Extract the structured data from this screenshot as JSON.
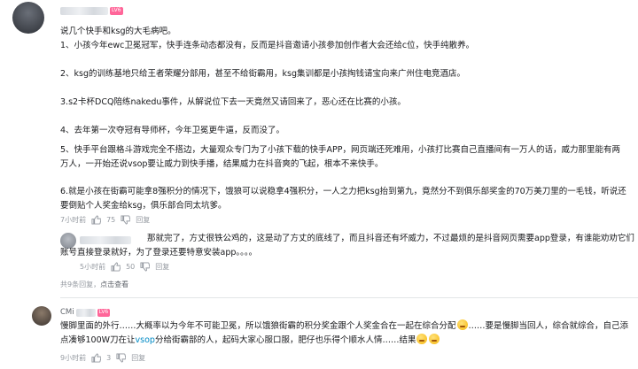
{
  "top_comment": {
    "level_badge": "LV6",
    "paragraphs": [
      "说几个快手和ksg的大毛病吧。",
      "1、小孩今年ewc卫冕冠军，快手连条动态都没有，反而是抖音邀请小孩参加创作者大会还给c位，快手纯散养。",
      "2、ksg的训练基地只给王者荣耀分部用，甚至不给街霸用，ksg集训都是小孩掏钱请宝向来广州住电竞酒店。",
      "3.s2卡杯DCQ陪练nakedu事件，从解说位下去一天竟然又请回来了，恶心还在比赛的小孩。",
      "4、去年第一次夺冠有导师杯，今年卫冕更牛逼，反而没了。",
      "5、快手平台跟格斗游戏完全不搭边，大量观众专门为了小孩下载的快手APP，网页端还死难用，小孩打比赛自己直播间有一万人的话，威力那里能有两万人，一开始还说vsop要让威力到快手播，结果威力在抖音爽的飞起，根本不来快手。",
      "6.就是小孩在街霸可能拿8强积分的情况下，饿狼可以说稳拿4强积分，一人之力把ksg抬到第九，竟然分不到俱乐部奖金的70万美刀里的一毛钱，听说还要倒贴个人奖金给ksg，俱乐部合同太坑爹。"
    ],
    "time": "7小时前",
    "likes": "75",
    "reply_label": "回复"
  },
  "reply": {
    "text": "那就完了，方丈很铁公鸡的，这是动了方丈的底线了，而且抖音还有坏威力，不过最烦的是抖音网页需要app登录，有谁能劝劝它们账号直接登录就好，为了登录还要特意安装app。。。。",
    "time": "5小时前",
    "likes": "50",
    "reply_label": "回复"
  },
  "reply_summary": {
    "count_text": "共9条回复，",
    "link_text": "点击查看"
  },
  "second_comment": {
    "username": "CMi",
    "level_badge": "LV6",
    "text_before": "慢脚里面的外行……大概率以为今年不可能卫冕，所以饿狼街霸的积分奖金跟个人奖金合在一起在综合分配",
    "text_mid": "……要是慢脚当回人，综合就综合，自己添点凑够100W刀在让",
    "vsop_text": "vsop",
    "text_after": "分给街霸部的人，起码大家心服口服，肥仔也乐得个顺水人情……结果",
    "time": "9小时前",
    "likes": "3",
    "reply_label": "回复"
  },
  "colors": {
    "text": "#18191c",
    "meta": "#9499a0",
    "link_blue": "#008ac5",
    "level_pink": "#ff6699",
    "divider": "#e3e5e7"
  },
  "icons": [
    "thumbs-up-icon",
    "thumbs-down-icon",
    "level-badge-icon",
    "emoji-icon"
  ]
}
